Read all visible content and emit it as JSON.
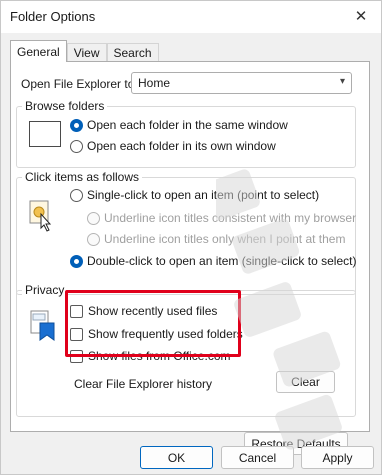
{
  "window": {
    "title": "Folder Options",
    "close_glyph": "✕"
  },
  "tabs": [
    {
      "label": "General",
      "active": true
    },
    {
      "label": "View",
      "active": false
    },
    {
      "label": "Search",
      "active": false
    }
  ],
  "open_explorer": {
    "label": "Open File Explorer to:",
    "value": "Home",
    "chevron": "▾"
  },
  "browse_folders": {
    "legend": "Browse folders",
    "options": [
      {
        "label": "Open each folder in the same window",
        "checked": true
      },
      {
        "label": "Open each folder in its own window",
        "checked": false
      }
    ]
  },
  "click_items": {
    "legend": "Click items as follows",
    "single_click": {
      "label": "Single-click to open an item (point to select)",
      "checked": false
    },
    "underline_consistent": {
      "label": "Underline icon titles consistent with my browser",
      "enabled": false
    },
    "underline_point": {
      "label": "Underline icon titles only when I point at them",
      "enabled": false
    },
    "double_click": {
      "label": "Double-click to open an item (single-click to select)",
      "checked": true
    }
  },
  "privacy": {
    "legend": "Privacy",
    "options": [
      {
        "label": "Show recently used files",
        "checked": false
      },
      {
        "label": "Show frequently used folders",
        "checked": false
      },
      {
        "label": "Show files from Office.com",
        "checked": false
      }
    ],
    "clear_history_label": "Clear File Explorer history",
    "clear_button": "Clear"
  },
  "restore_defaults": "Restore Defaults",
  "footer": {
    "ok": "OK",
    "cancel": "Cancel",
    "apply": "Apply"
  },
  "icons": {
    "browse": "window-frame-icon",
    "click": "pointer-icon",
    "privacy": "privacy-shield-icon"
  },
  "colors": {
    "accent": "#005fb8",
    "highlight": "#e0001b"
  }
}
